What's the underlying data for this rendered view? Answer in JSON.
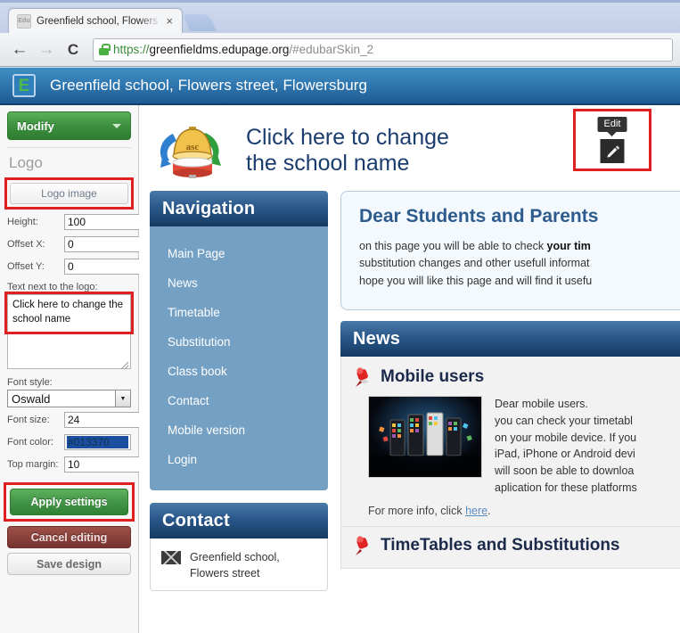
{
  "browser": {
    "tab": {
      "favicon_label": "Edu",
      "title": "Greenfield school, Flowers st",
      "close_label": "×"
    },
    "nav": {
      "back": "←",
      "forward": "→",
      "reload": "C"
    },
    "url": {
      "scheme": "https://",
      "host": "greenfieldms.edupage.org",
      "path": "/#edubarSkin_2",
      "full": "https://greenfieldms.edupage.org/#edubarSkin_2"
    }
  },
  "sitebar": {
    "logo_letter": "E",
    "title": "Greenfield school, Flowers street, Flowersburg"
  },
  "sidebar": {
    "modify_label": "Modify",
    "section_title": "Logo",
    "logo_image_button": "Logo image",
    "fields": [
      {
        "label": "Height:",
        "value": "100"
      },
      {
        "label": "Offset X:",
        "value": "0"
      },
      {
        "label": "Offset Y:",
        "value": "0"
      }
    ],
    "text_next_label": "Text next to the logo:",
    "text_next_value": "Click here to change the school name",
    "font_style_label": "Font style:",
    "font_style_value": "Oswald",
    "font_size_label": "Font size:",
    "font_size_value": "24",
    "font_color_label": "Font color:",
    "font_color_value": "#013370",
    "top_margin_label": "Top margin:",
    "top_margin_value": "10",
    "apply_label": "Apply settings",
    "cancel_label": "Cancel editing",
    "save_label": "Save design"
  },
  "hero": {
    "title": "Click here to change the school name",
    "logo_text": "asc",
    "edit_tooltip": "Edit"
  },
  "navigation": {
    "heading": "Navigation",
    "items": [
      {
        "label": "Main Page"
      },
      {
        "label": "News"
      },
      {
        "label": "Timetable"
      },
      {
        "label": "Substitution"
      },
      {
        "label": "Class book"
      },
      {
        "label": "Contact"
      },
      {
        "label": "Mobile version"
      },
      {
        "label": "Login"
      }
    ]
  },
  "contact": {
    "heading": "Contact",
    "line1": "Greenfield school,",
    "line2": "Flowers street"
  },
  "info": {
    "title": "Dear Students and Parents",
    "line1_a": "on this page you will be able to check ",
    "line1_b": "your tim",
    "line2": "substitution changes and other usefull informat",
    "line3": "hope you will like this page and will find it usefu"
  },
  "news": {
    "heading": "News",
    "item1": {
      "title": "Mobile users",
      "lines": [
        "Dear mobile users.",
        "you can check your timetabl",
        "on your mobile device. If you",
        "iPad, iPhone or Android devi",
        "will soon be able to downloa",
        "aplication for these platforms"
      ],
      "more_prefix": "For more info, click ",
      "more_link": "here",
      "more_suffix": "."
    },
    "item2": {
      "title": "TimeTables and Substitutions"
    }
  },
  "colors": {
    "accent_blue": "#2d5b8e",
    "nav_body": "#74a0c4",
    "green_button": "#3f9140",
    "red_highlight": "#e02020",
    "font_color_value": "#013370"
  }
}
